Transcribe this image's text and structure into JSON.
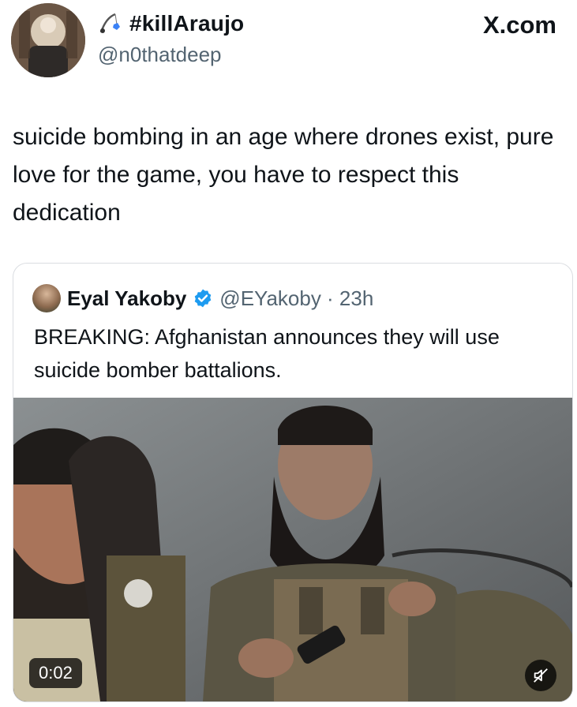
{
  "author": {
    "display_name": "#killAraujo",
    "handle": "@n0thatdeep",
    "name_emoji": "fishing-rod-icon"
  },
  "site_label": "X.com",
  "tweet": {
    "text": "suicide bombing in an age where drones exist, pure love for the game, you have to respect this dedication"
  },
  "quoted_tweet": {
    "display_name": "Eyal Yakoby",
    "verified": true,
    "handle_time": "@EYakoby · 23h",
    "text": "BREAKING: Afghanistan announces they will use suicide bomber battalions.",
    "media": {
      "type": "video",
      "duration": "0:02",
      "muted": true
    }
  },
  "colors": {
    "text": "#0f1419",
    "secondary": "#536471",
    "verified": "#1d9bf0",
    "border": "#dadde1"
  }
}
